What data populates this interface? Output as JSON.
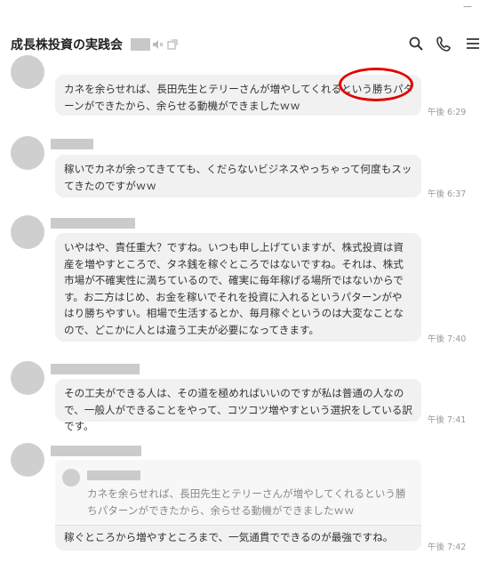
{
  "window": {
    "minimize_label": "—"
  },
  "header": {
    "title": "成長株投資の実践会",
    "icons": [
      "mute-icon",
      "external-link-icon",
      "search-icon",
      "phone-icon",
      "menu-icon"
    ]
  },
  "messages": [
    {
      "text": "カネを余らせれば、長田先生とテリーさんが増やしてくれるという勝ちパターンができたから、余らせる動機ができましたｗｗ",
      "time": "午後 6:29"
    },
    {
      "text": "稼いでカネが余ってきてても、くだらないビジネスやっちゃって何度もスッてきたのですがｗｗ",
      "time": "午後 6:37"
    },
    {
      "text": "いやはや、責任重大？ですね。いつも申し上げていますが、株式投資は資産を増やすところで、タネ銭を稼ぐところではないですね。それは、株式市場が不確実性に満ちているので、確実に毎年稼げる場所ではないからです。お二方はじめ、お金を稼いでそれを投資に入れるというパターンがやはり勝ちやすい。相場で生活するとか、毎月稼ぐというのは大変なことなので、どこかに人とは違う工夫が必要になってきます。",
      "time": "午後 7:40"
    },
    {
      "text": "その工夫ができる人は、その道を極めればいいのですが私は普通の人なので、一般人ができることをやって、コツコツ増やすという選択をしている訳です。",
      "time": "午後 7:41"
    },
    {
      "quote": "カネを余らせれば、長田先生とテリーさんが増やしてくれるという勝ちパターンができたから、余らせる動機ができましたｗｗ",
      "text": "稼ぐところから増やすところまで、一気通貫でできるのが最強ですね。",
      "time": "午後 7:42"
    }
  ]
}
